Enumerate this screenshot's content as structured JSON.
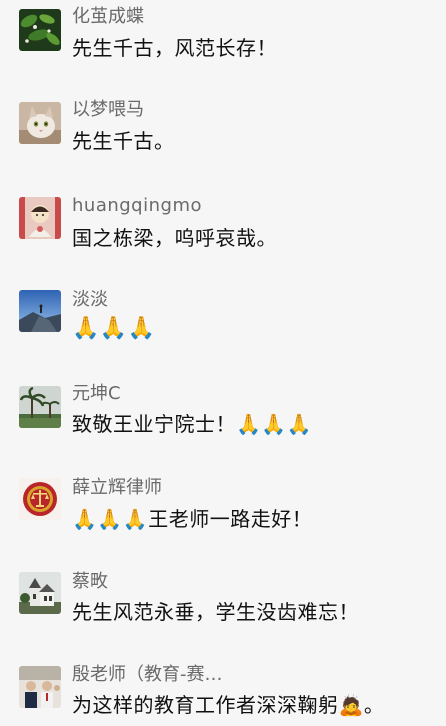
{
  "comments": [
    {
      "avatar_icon": "green-leaves-avatar-icon",
      "name": "化茧成蝶",
      "text": "先生千古，风范长存！"
    },
    {
      "avatar_icon": "cat-avatar-icon",
      "name": "以梦喂马",
      "text": "先生千古。"
    },
    {
      "avatar_icon": "cartoon-child-avatar-icon",
      "name": "huangqingmo",
      "text": "国之栋梁，呜呼哀哉。"
    },
    {
      "avatar_icon": "mountain-sky-avatar-icon",
      "name": "淡淡",
      "text": "🙏🙏🙏"
    },
    {
      "avatar_icon": "palm-tree-avatar-icon",
      "name": "元坤C",
      "text": "致敬王业宁院士！🙏🙏🙏"
    },
    {
      "avatar_icon": "court-emblem-avatar-icon",
      "name": "薛立辉律师",
      "text": "🙏🙏🙏王老师一路走好！"
    },
    {
      "avatar_icon": "church-building-avatar-icon",
      "name": "蔡畋",
      "text": "先生风范永垂，学生没齿难忘！"
    },
    {
      "avatar_icon": "group-photo-avatar-icon",
      "name": "殷老师（教育-赛…",
      "text": "为这样的教育工作者深深鞠躬🙇。"
    }
  ]
}
